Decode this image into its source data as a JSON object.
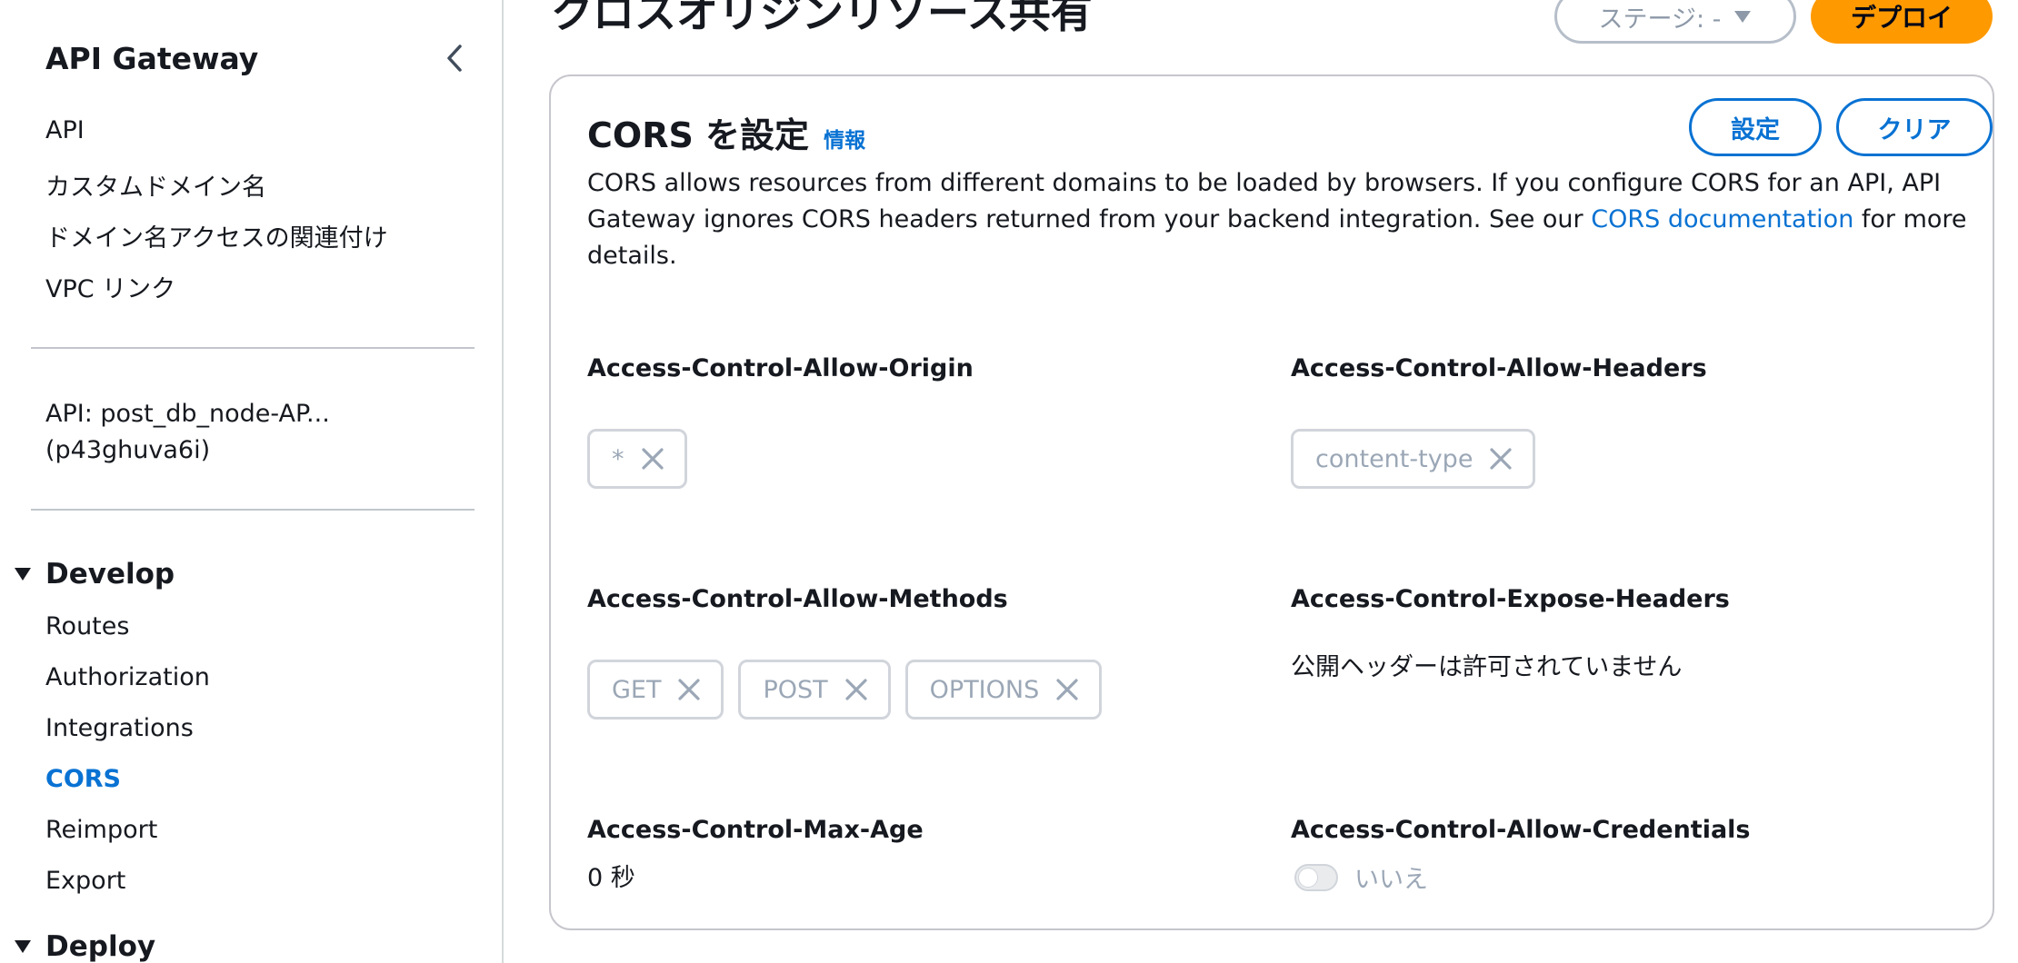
{
  "sidebar": {
    "title": "API Gateway",
    "nav": [
      "API",
      "カスタムドメイン名",
      "ドメイン名アクセスの関連付け",
      "VPC リンク"
    ],
    "api_line1": "API: post_db_node-AP...",
    "api_line2": "(p43ghuva6i)",
    "develop": {
      "label": "Develop",
      "items": [
        "Routes",
        "Authorization",
        "Integrations",
        "CORS",
        "Reimport",
        "Export"
      ],
      "active": "CORS"
    },
    "deploy": {
      "label": "Deploy"
    }
  },
  "header": {
    "title": "クロスオリジンリソース共有",
    "stage_select": "ステージ: -",
    "deploy_label": "デプロイ"
  },
  "card": {
    "title": "CORS を設定",
    "info_label": "情報",
    "configure_label": "設定",
    "clear_label": "クリア",
    "desc_before": "CORS allows resources from different domains to be loaded by browsers. If you configure CORS for an API, API Gateway ignores CORS headers returned from your backend integration. See our ",
    "desc_link": "CORS documentation",
    "desc_after": " for more details.",
    "allow_origin": {
      "label": "Access-Control-Allow-Origin",
      "values": [
        "*"
      ]
    },
    "allow_headers": {
      "label": "Access-Control-Allow-Headers",
      "values": [
        "content-type"
      ]
    },
    "allow_methods": {
      "label": "Access-Control-Allow-Methods",
      "values": [
        "GET",
        "POST",
        "OPTIONS"
      ]
    },
    "expose_headers": {
      "label": "Access-Control-Expose-Headers",
      "value": "公開ヘッダーは許可されていません"
    },
    "max_age": {
      "label": "Access-Control-Max-Age",
      "value": "0 秒"
    },
    "allow_credentials": {
      "label": "Access-Control-Allow-Credentials",
      "value": "いいえ"
    }
  },
  "colors": {
    "accent": "#0972d3",
    "deploy": "#ff9900",
    "border": "#c6c6cd",
    "token_text": "#9ba7b6"
  },
  "icons": [
    "chevron-left-icon",
    "caret-down-icon",
    "close-icon"
  ]
}
